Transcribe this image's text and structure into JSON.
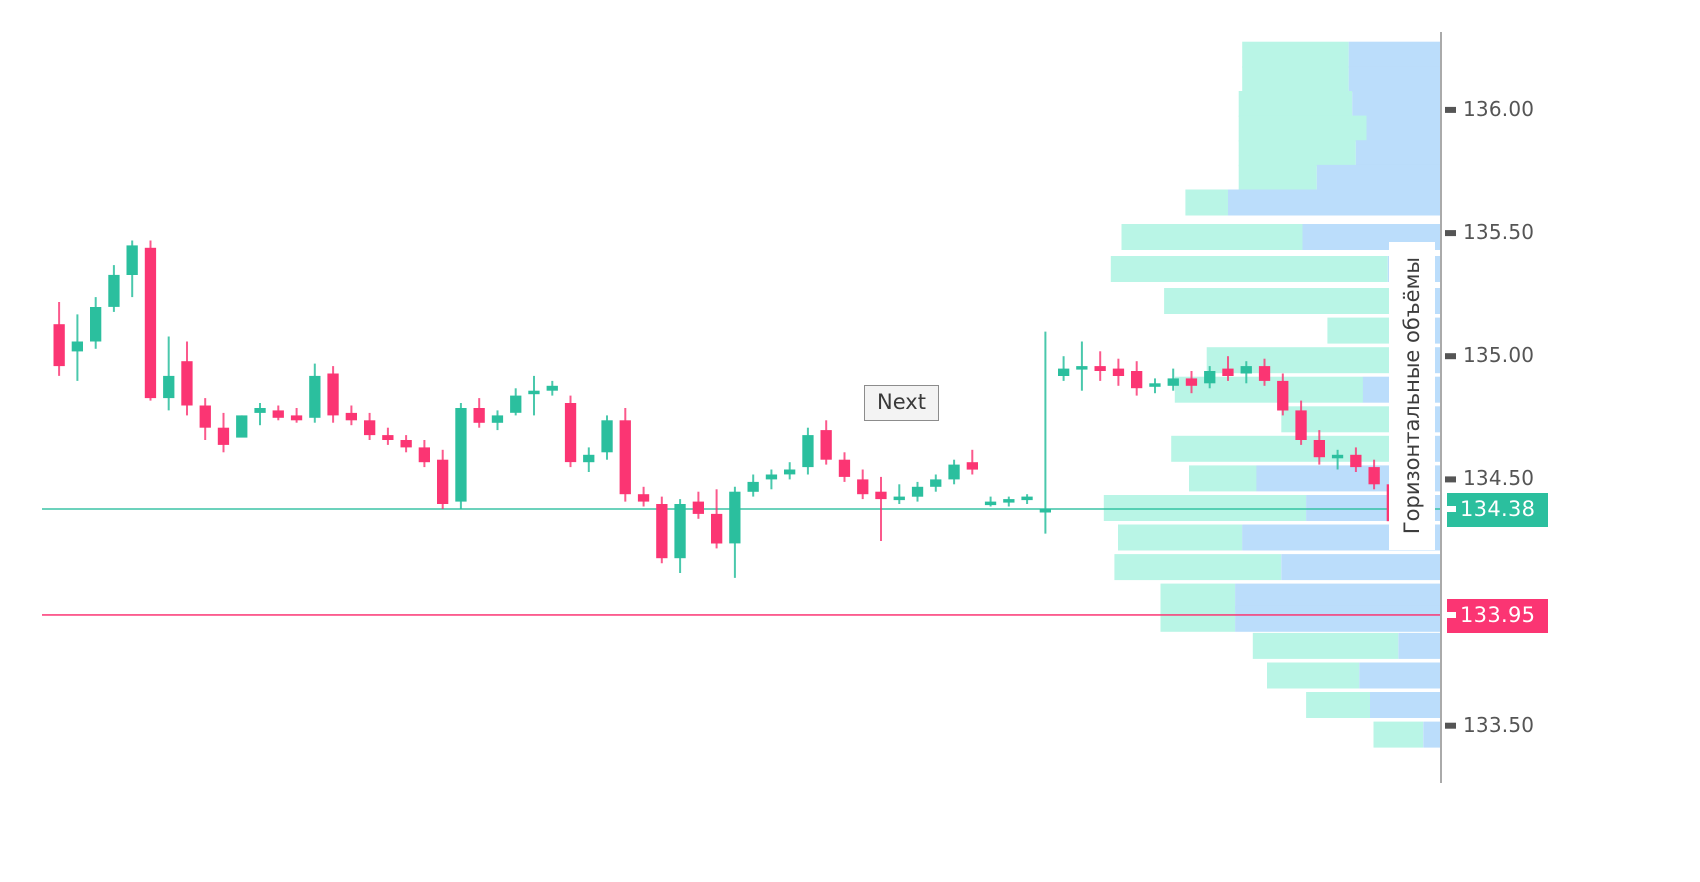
{
  "chart_data": {
    "type": "candlestick",
    "title": "",
    "xlabel": "",
    "ylabel": "",
    "ylim": [
      133.3,
      136.3
    ],
    "grid": false,
    "legend": false,
    "price_axis": {
      "side": "right",
      "ticks": [
        "136.00",
        "135.50",
        "135.00",
        "134.50",
        "133.50"
      ],
      "tick_values": [
        136.0,
        135.5,
        135.0,
        134.5,
        133.5
      ]
    },
    "price_markers": [
      {
        "label": "134.38",
        "value": 134.38,
        "color": "#2bbf9e",
        "kind": "current-price"
      },
      {
        "label": "133.95",
        "value": 133.95,
        "color": "#fb3573",
        "kind": "reference-price"
      }
    ],
    "colors": {
      "up": "#2bbf9e",
      "down": "#fb3573",
      "profile_buy": "#b9f5e6",
      "profile_sell": "#bbddfb",
      "axis": "#aaaaaa",
      "tick_text": "#555555"
    },
    "candles": [
      {
        "o": 135.13,
        "h": 135.22,
        "l": 134.92,
        "c": 134.96
      },
      {
        "o": 135.02,
        "h": 135.17,
        "l": 134.9,
        "c": 135.06
      },
      {
        "o": 135.06,
        "h": 135.24,
        "l": 135.03,
        "c": 135.2
      },
      {
        "o": 135.2,
        "h": 135.37,
        "l": 135.18,
        "c": 135.33
      },
      {
        "o": 135.33,
        "h": 135.47,
        "l": 135.24,
        "c": 135.45
      },
      {
        "o": 135.44,
        "h": 135.47,
        "l": 134.82,
        "c": 134.83
      },
      {
        "o": 134.83,
        "h": 135.08,
        "l": 134.78,
        "c": 134.92
      },
      {
        "o": 134.98,
        "h": 135.06,
        "l": 134.76,
        "c": 134.8
      },
      {
        "o": 134.8,
        "h": 134.83,
        "l": 134.66,
        "c": 134.71
      },
      {
        "o": 134.71,
        "h": 134.77,
        "l": 134.61,
        "c": 134.64
      },
      {
        "o": 134.67,
        "h": 134.76,
        "l": 134.68,
        "c": 134.76
      },
      {
        "o": 134.77,
        "h": 134.81,
        "l": 134.72,
        "c": 134.79
      },
      {
        "o": 134.78,
        "h": 134.8,
        "l": 134.74,
        "c": 134.75
      },
      {
        "o": 134.76,
        "h": 134.79,
        "l": 134.73,
        "c": 134.74
      },
      {
        "o": 134.75,
        "h": 134.97,
        "l": 134.73,
        "c": 134.92
      },
      {
        "o": 134.93,
        "h": 134.96,
        "l": 134.73,
        "c": 134.76
      },
      {
        "o": 134.77,
        "h": 134.8,
        "l": 134.72,
        "c": 134.74
      },
      {
        "o": 134.74,
        "h": 134.77,
        "l": 134.66,
        "c": 134.68
      },
      {
        "o": 134.68,
        "h": 134.71,
        "l": 134.64,
        "c": 134.66
      },
      {
        "o": 134.66,
        "h": 134.68,
        "l": 134.61,
        "c": 134.63
      },
      {
        "o": 134.63,
        "h": 134.66,
        "l": 134.55,
        "c": 134.57
      },
      {
        "o": 134.58,
        "h": 134.62,
        "l": 134.38,
        "c": 134.4
      },
      {
        "o": 134.41,
        "h": 134.81,
        "l": 134.38,
        "c": 134.79
      },
      {
        "o": 134.79,
        "h": 134.83,
        "l": 134.71,
        "c": 134.73
      },
      {
        "o": 134.73,
        "h": 134.78,
        "l": 134.7,
        "c": 134.76
      },
      {
        "o": 134.77,
        "h": 134.87,
        "l": 134.76,
        "c": 134.84
      },
      {
        "o": 134.85,
        "h": 134.92,
        "l": 134.76,
        "c": 134.86
      },
      {
        "o": 134.86,
        "h": 134.9,
        "l": 134.84,
        "c": 134.88
      },
      {
        "o": 134.81,
        "h": 134.84,
        "l": 134.55,
        "c": 134.57
      },
      {
        "o": 134.57,
        "h": 134.63,
        "l": 134.53,
        "c": 134.6
      },
      {
        "o": 134.61,
        "h": 134.76,
        "l": 134.58,
        "c": 134.74
      },
      {
        "o": 134.74,
        "h": 134.79,
        "l": 134.41,
        "c": 134.44
      },
      {
        "o": 134.44,
        "h": 134.47,
        "l": 134.39,
        "c": 134.41
      },
      {
        "o": 134.4,
        "h": 134.43,
        "l": 134.16,
        "c": 134.18
      },
      {
        "o": 134.18,
        "h": 134.42,
        "l": 134.12,
        "c": 134.4
      },
      {
        "o": 134.41,
        "h": 134.45,
        "l": 134.34,
        "c": 134.36
      },
      {
        "o": 134.36,
        "h": 134.46,
        "l": 134.22,
        "c": 134.24
      },
      {
        "o": 134.24,
        "h": 134.47,
        "l": 134.1,
        "c": 134.45
      },
      {
        "o": 134.45,
        "h": 134.52,
        "l": 134.43,
        "c": 134.49
      },
      {
        "o": 134.5,
        "h": 134.54,
        "l": 134.46,
        "c": 134.52
      },
      {
        "o": 134.52,
        "h": 134.57,
        "l": 134.5,
        "c": 134.54
      },
      {
        "o": 134.55,
        "h": 134.71,
        "l": 134.52,
        "c": 134.68
      },
      {
        "o": 134.7,
        "h": 134.74,
        "l": 134.56,
        "c": 134.58
      },
      {
        "o": 134.58,
        "h": 134.61,
        "l": 134.49,
        "c": 134.51
      },
      {
        "o": 134.5,
        "h": 134.54,
        "l": 134.42,
        "c": 134.44
      },
      {
        "o": 134.45,
        "h": 134.51,
        "l": 134.25,
        "c": 134.42
      },
      {
        "o": 134.42,
        "h": 134.48,
        "l": 134.4,
        "c": 134.43
      },
      {
        "o": 134.43,
        "h": 134.49,
        "l": 134.41,
        "c": 134.47
      },
      {
        "o": 134.47,
        "h": 134.52,
        "l": 134.45,
        "c": 134.5
      },
      {
        "o": 134.5,
        "h": 134.58,
        "l": 134.48,
        "c": 134.56
      },
      {
        "o": 134.57,
        "h": 134.62,
        "l": 134.52,
        "c": 134.54
      },
      {
        "o": 134.4,
        "h": 134.43,
        "l": 134.39,
        "c": 134.41
      },
      {
        "o": 134.41,
        "h": 134.43,
        "l": 134.39,
        "c": 134.42
      },
      {
        "o": 134.42,
        "h": 134.44,
        "l": 134.4,
        "c": 134.43
      },
      {
        "o": 134.38,
        "h": 135.1,
        "l": 134.28,
        "c": 134.38
      },
      {
        "o": 134.92,
        "h": 135.0,
        "l": 134.9,
        "c": 134.95
      },
      {
        "o": 134.95,
        "h": 135.06,
        "l": 134.86,
        "c": 134.96
      },
      {
        "o": 134.96,
        "h": 135.02,
        "l": 134.9,
        "c": 134.94
      },
      {
        "o": 134.95,
        "h": 134.99,
        "l": 134.88,
        "c": 134.92
      },
      {
        "o": 134.94,
        "h": 134.98,
        "l": 134.84,
        "c": 134.87
      },
      {
        "o": 134.88,
        "h": 134.91,
        "l": 134.85,
        "c": 134.89
      },
      {
        "o": 134.88,
        "h": 134.95,
        "l": 134.86,
        "c": 134.91
      },
      {
        "o": 134.91,
        "h": 134.94,
        "l": 134.85,
        "c": 134.88
      },
      {
        "o": 134.89,
        "h": 134.96,
        "l": 134.87,
        "c": 134.94
      },
      {
        "o": 134.95,
        "h": 135.0,
        "l": 134.9,
        "c": 134.92
      },
      {
        "o": 134.93,
        "h": 134.98,
        "l": 134.89,
        "c": 134.96
      },
      {
        "o": 134.96,
        "h": 134.99,
        "l": 134.88,
        "c": 134.9
      },
      {
        "o": 134.9,
        "h": 134.93,
        "l": 134.76,
        "c": 134.78
      },
      {
        "o": 134.78,
        "h": 134.82,
        "l": 134.64,
        "c": 134.66
      },
      {
        "o": 134.66,
        "h": 134.7,
        "l": 134.56,
        "c": 134.59
      },
      {
        "o": 134.59,
        "h": 134.62,
        "l": 134.54,
        "c": 134.6
      },
      {
        "o": 134.6,
        "h": 134.63,
        "l": 134.53,
        "c": 134.55
      },
      {
        "o": 134.55,
        "h": 134.58,
        "l": 134.46,
        "c": 134.48
      },
      {
        "o": 134.48,
        "h": 134.52,
        "l": 134.3,
        "c": 134.33
      },
      {
        "o": 134.33,
        "h": 134.36,
        "l": 134.26,
        "c": 134.29
      },
      {
        "o": 134.26,
        "h": 134.5,
        "l": 134.24,
        "c": 134.5
      }
    ],
    "volume_profile": {
      "orientation": "horizontal",
      "title": "Горизонтальные объёмы",
      "rows": [
        {
          "price": 136.22,
          "buy": 0.3,
          "sell": 0.26
        },
        {
          "price": 136.12,
          "buy": 0.3,
          "sell": 0.26
        },
        {
          "price": 136.02,
          "buy": 0.32,
          "sell": 0.25
        },
        {
          "price": 135.92,
          "buy": 0.36,
          "sell": 0.21
        },
        {
          "price": 135.82,
          "buy": 0.33,
          "sell": 0.24
        },
        {
          "price": 135.72,
          "buy": 0.22,
          "sell": 0.35
        },
        {
          "price": 135.62,
          "buy": 0.12,
          "sell": 0.6
        },
        {
          "price": 135.48,
          "buy": 0.51,
          "sell": 0.39
        },
        {
          "price": 135.35,
          "buy": 0.78,
          "sell": 0.15
        },
        {
          "price": 135.22,
          "buy": 0.65,
          "sell": 0.13
        },
        {
          "price": 135.1,
          "buy": 0.2,
          "sell": 0.12
        },
        {
          "price": 134.98,
          "buy": 0.6,
          "sell": 0.06
        },
        {
          "price": 134.86,
          "buy": 0.53,
          "sell": 0.22
        },
        {
          "price": 134.74,
          "buy": 0.35,
          "sell": 0.1
        },
        {
          "price": 134.62,
          "buy": 0.68,
          "sell": 0.08
        },
        {
          "price": 134.5,
          "buy": 0.19,
          "sell": 0.52
        },
        {
          "price": 134.38,
          "buy": 0.57,
          "sell": 0.38
        },
        {
          "price": 134.26,
          "buy": 0.35,
          "sell": 0.56
        },
        {
          "price": 134.14,
          "buy": 0.47,
          "sell": 0.45
        },
        {
          "price": 134.02,
          "buy": 0.21,
          "sell": 0.58
        },
        {
          "price": 133.93,
          "buy": 0.21,
          "sell": 0.58
        },
        {
          "price": 133.82,
          "buy": 0.41,
          "sell": 0.12
        },
        {
          "price": 133.7,
          "buy": 0.26,
          "sell": 0.23
        },
        {
          "price": 133.58,
          "buy": 0.18,
          "sell": 0.2
        },
        {
          "price": 133.46,
          "buy": 0.14,
          "sell": 0.05
        }
      ]
    }
  },
  "controls": {
    "next_button_label": "Next"
  }
}
